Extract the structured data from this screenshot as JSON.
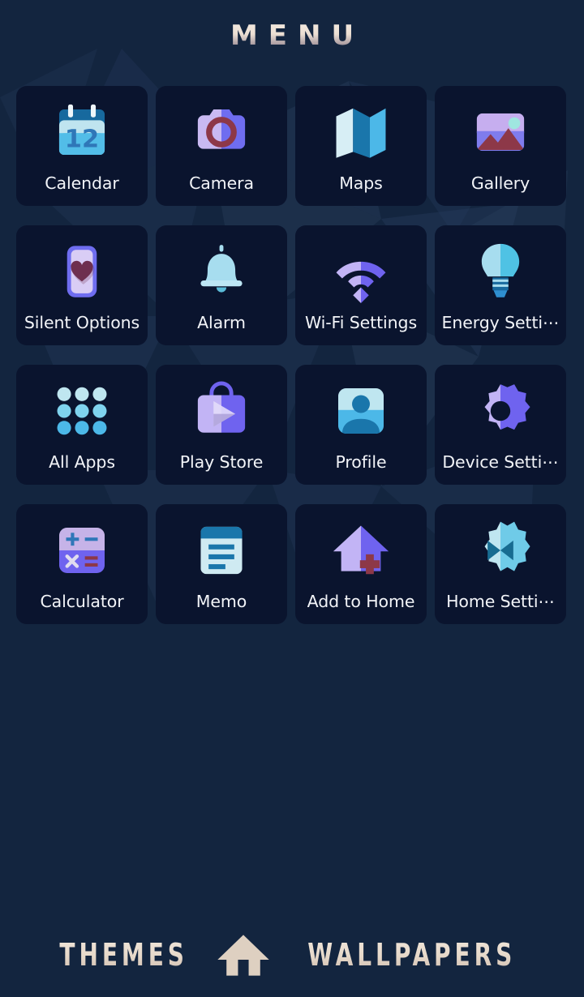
{
  "header": {
    "title": "MENU"
  },
  "theme": {
    "page_bg": "#13253f",
    "tile_bg": "#0a142e",
    "label_color": "#f2f4f8",
    "accent_cream": "#ecdfd3",
    "accent_cyan": "#7fd3ee",
    "accent_periwinkle": "#6f6df0",
    "accent_lavender": "#c2b4f5",
    "accent_maroon": "#8d3848",
    "accent_blue": "#2f8fd0",
    "accent_teal": "#17699e"
  },
  "grid": {
    "columns": 4,
    "rows": 4,
    "apps": [
      {
        "label": "Calendar",
        "icon": "calendar-icon"
      },
      {
        "label": "Camera",
        "icon": "camera-icon"
      },
      {
        "label": "Maps",
        "icon": "maps-icon"
      },
      {
        "label": "Gallery",
        "icon": "gallery-icon"
      },
      {
        "label": "Silent Options",
        "icon": "silent-options-icon"
      },
      {
        "label": "Alarm",
        "icon": "alarm-bell-icon"
      },
      {
        "label": "Wi-Fi Settings",
        "icon": "wifi-icon"
      },
      {
        "label": "Energy Setti⋯",
        "icon": "lightbulb-icon"
      },
      {
        "label": "All Apps",
        "icon": "all-apps-grid-icon"
      },
      {
        "label": "Play Store",
        "icon": "play-store-icon"
      },
      {
        "label": "Profile",
        "icon": "profile-avatar-icon"
      },
      {
        "label": "Device Setti⋯",
        "icon": "gear-icon"
      },
      {
        "label": "Calculator",
        "icon": "calculator-icon"
      },
      {
        "label": "Memo",
        "icon": "memo-icon"
      },
      {
        "label": "Add to Home",
        "icon": "add-to-home-house-icon"
      },
      {
        "label": "Home Setti⋯",
        "icon": "home-settings-gear-icon"
      }
    ],
    "calendar_day": "12"
  },
  "bottom_bar": {
    "themes_label": "THEMES",
    "home_icon": "home-icon",
    "wallpapers_label": "WALLPAPERS"
  }
}
